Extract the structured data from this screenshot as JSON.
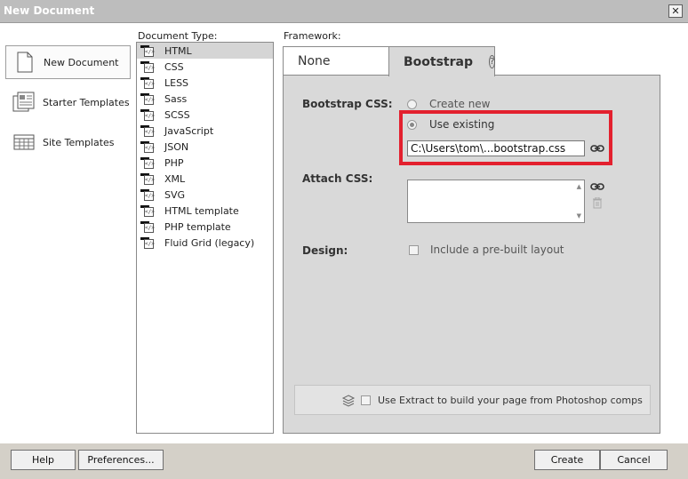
{
  "window": {
    "title": "New Document",
    "close_glyph": "✕"
  },
  "categories": [
    {
      "label": "New Document",
      "icon": "blank-page-icon",
      "selected": true
    },
    {
      "label": "Starter Templates",
      "icon": "starter-templates-icon",
      "selected": false
    },
    {
      "label": "Site Templates",
      "icon": "site-templates-icon",
      "selected": false
    }
  ],
  "document_type": {
    "label": "Document Type:",
    "items": [
      "HTML",
      "CSS",
      "LESS",
      "Sass",
      "SCSS",
      "JavaScript",
      "JSON",
      "PHP",
      "XML",
      "SVG",
      "HTML template",
      "PHP template",
      "Fluid Grid (legacy)"
    ],
    "selected": "HTML"
  },
  "framework": {
    "label": "Framework:",
    "tabs": {
      "none": "None",
      "bootstrap": "Bootstrap",
      "help": "?"
    },
    "active_tab": "Bootstrap",
    "bootstrap_css": {
      "label": "Bootstrap CSS:",
      "create_new": "Create new",
      "use_existing": "Use existing",
      "selected": "Use existing",
      "path": "C:\\Users\\tom\\...bootstrap.css"
    },
    "attach_css": {
      "label": "Attach CSS:"
    },
    "design": {
      "label": "Design:",
      "checkbox": "Include a pre-built layout",
      "checked": false
    },
    "extract": {
      "text": "Use Extract to build your page from Photoshop comps",
      "checked": false
    }
  },
  "buttons": {
    "help": "Help",
    "preferences": "Preferences...",
    "create": "Create",
    "cancel": "Cancel"
  },
  "colors": {
    "highlight": "#e3202e",
    "panel": "#d9d9d9",
    "titlebar": "#bdbdbd"
  }
}
